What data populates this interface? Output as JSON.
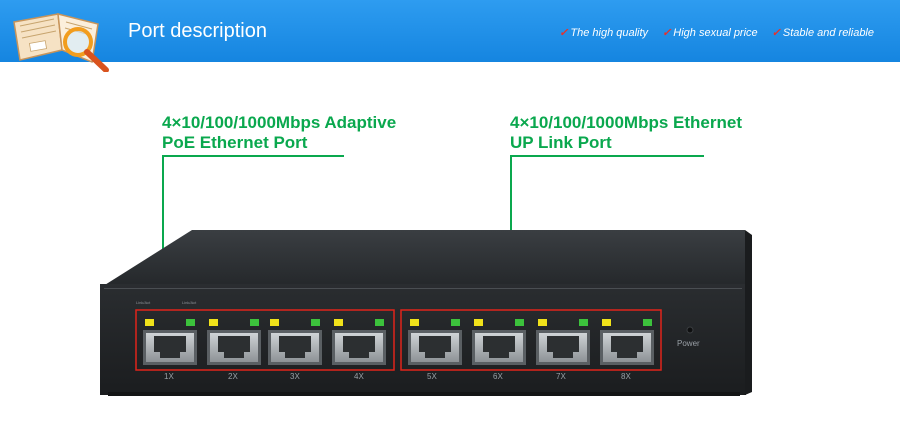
{
  "header": {
    "title": "Port description",
    "slogans": [
      "The high quality",
      "High sexual price",
      "Stable and reliable"
    ]
  },
  "callouts": {
    "left": {
      "line1": "4×10/100/1000Mbps Adaptive",
      "line2": "PoE Ethernet Port"
    },
    "right": {
      "line1": "4×10/100/1000Mbps Ethernet",
      "line2": "UP Link Port"
    }
  },
  "device": {
    "ports": [
      "1X",
      "2X",
      "3X",
      "4X",
      "5X",
      "6X",
      "7X",
      "8X"
    ],
    "power_label": "Power",
    "led_labels": [
      "Link/Act",
      "Link/Act"
    ]
  },
  "colors": {
    "banner": "#1a8ae6",
    "accent_green": "#0aa84e",
    "highlight_red": "#e0241b",
    "led_yellow": "#f0e21a",
    "led_green": "#3cc23c"
  }
}
